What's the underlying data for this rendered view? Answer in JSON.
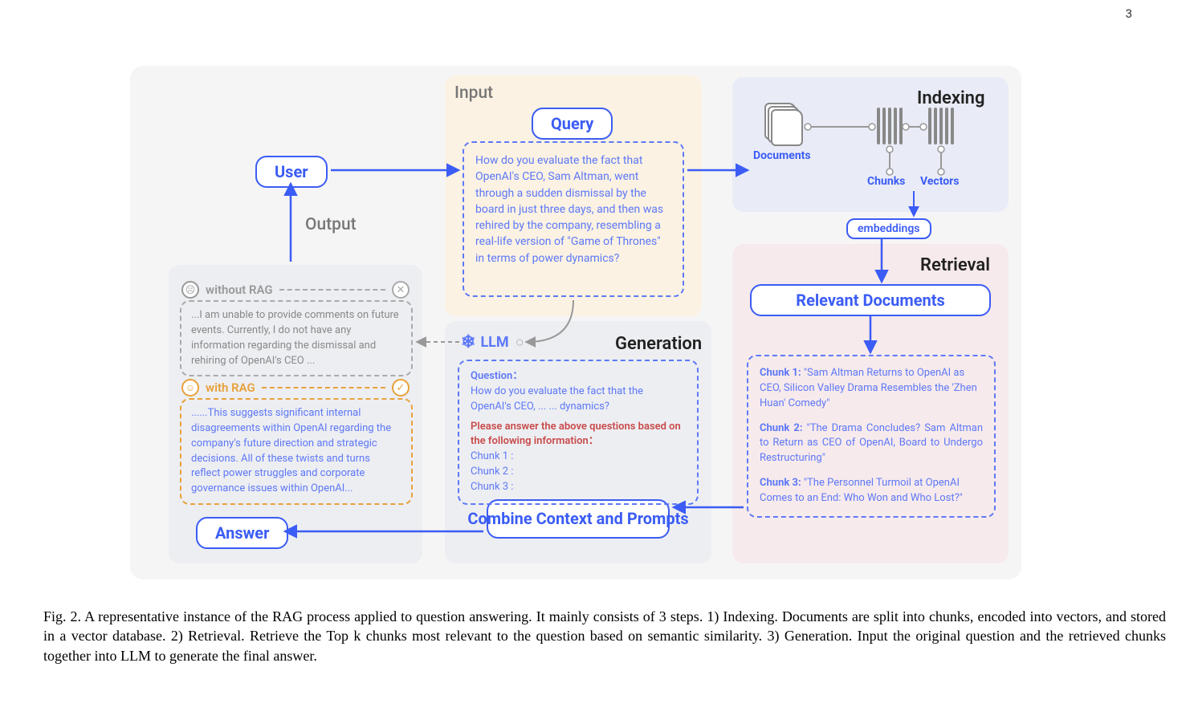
{
  "page_number": "3",
  "diagram": {
    "sections": {
      "input": "Input",
      "output": "Output",
      "indexing": "Indexing",
      "retrieval": "Retrieval",
      "generation": "Generation"
    },
    "nodes": {
      "user": "User",
      "query": "Query",
      "answer": "Answer",
      "relevant_docs": "Relevant Documents",
      "combine": "Combine Context and Prompts",
      "embeddings": "embeddings",
      "llm": "LLM",
      "documents_label": "Documents",
      "chunks_label": "Chunks",
      "vectors_label": "Vectors"
    },
    "query_text": "How do you evaluate the fact that OpenAI's CEO, Sam Altman, went through a sudden dismissal by the board in just three days, and then was rehired by the company, resembling a real-life version of \"Game of Thrones\" in terms of power dynamics?",
    "without_rag": {
      "label": "without RAG",
      "text": "...I am unable to provide comments on future events. Currently, I do not have any information regarding the dismissal and rehiring of OpenAI's CEO ..."
    },
    "with_rag": {
      "label": "with RAG",
      "text": "......This suggests significant internal disagreements within OpenAI regarding the company's future direction and strategic decisions. All of these twists and turns reflect power struggles and corporate governance issues within OpenAI..."
    },
    "prompt": {
      "question_head": "Question：",
      "question_body": "How do you evaluate the fact that the OpenAI's CEO, ... ... dynamics?",
      "instruction": "Please answer the above questions based on the following information：",
      "chunk1": "Chunk 1 :",
      "chunk2": "Chunk 2 :",
      "chunk3": "Chunk 3 :"
    },
    "chunks": {
      "c1_label": "Chunk 1:",
      "c1_text": " \"Sam Altman Returns to OpenAI as CEO, Silicon Valley Drama Resembles the 'Zhen Huan' Comedy\"",
      "c2_label": "Chunk 2:",
      "c2_text": " \"The Drama Concludes? Sam Altman to Return as CEO of OpenAI, Board to Undergo Restructuring\"",
      "c3_label": "Chunk 3:",
      "c3_text": " \"The Personnel Turmoil at OpenAI Comes to an End: Who Won and Who Lost?\""
    }
  },
  "caption": "Fig. 2.  A representative instance of the RAG process applied to question answering. It mainly consists of 3 steps. 1) Indexing. Documents are split into chunks, encoded into vectors, and stored in a vector database. 2) Retrieval. Retrieve the Top k chunks most relevant to the question based on semantic similarity. 3) Generation. Input the original question and the retrieved chunks together into LLM to generate the final answer."
}
